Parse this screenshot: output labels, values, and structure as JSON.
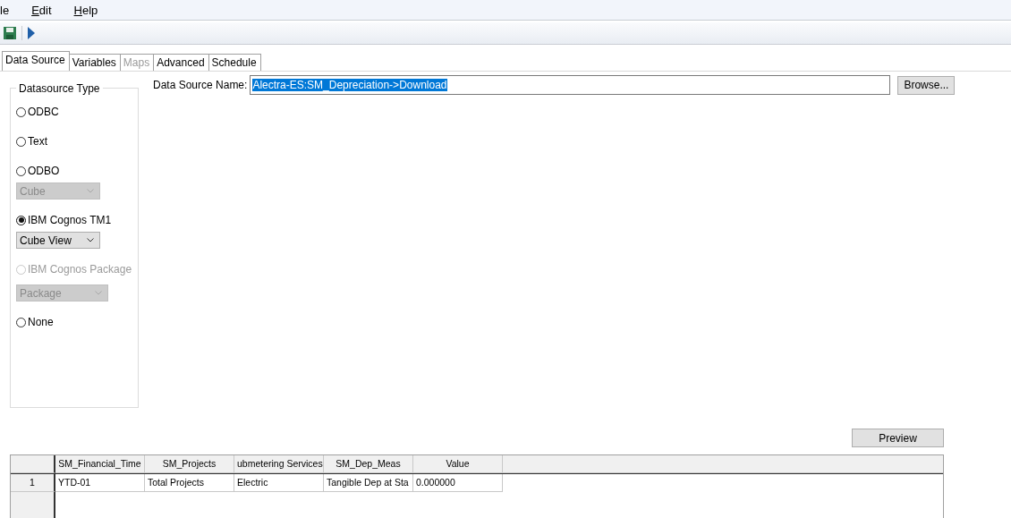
{
  "menu": [
    {
      "label": "le",
      "mnemonic": false
    },
    {
      "label": "Edit",
      "mnemonic": true
    },
    {
      "label": "Help",
      "mnemonic": true
    }
  ],
  "toolbar": [
    {
      "kind": "save"
    },
    {
      "kind": "run"
    }
  ],
  "tabs": [
    {
      "label": "Data Source",
      "selected": true,
      "disabled": false
    },
    {
      "label": "Variables",
      "selected": false,
      "disabled": false
    },
    {
      "label": "Maps",
      "selected": false,
      "disabled": true
    },
    {
      "label": "Advanced",
      "selected": false,
      "disabled": false
    },
    {
      "label": "Schedule",
      "selected": false,
      "disabled": false
    }
  ],
  "datasource_type": {
    "title": "Datasource Type",
    "items": [
      {
        "kind": "radio",
        "label": "ODBC",
        "selected": false,
        "disabled": false
      },
      {
        "kind": "radio",
        "label": "Text",
        "selected": false,
        "disabled": false
      },
      {
        "kind": "radio",
        "label": "ODBO",
        "selected": false,
        "disabled": false
      },
      {
        "kind": "dropdown",
        "value": "Cube",
        "disabled": true
      },
      {
        "kind": "radio",
        "label": "IBM Cognos TM1",
        "selected": true,
        "disabled": false
      },
      {
        "kind": "dropdown",
        "value": "Cube View",
        "disabled": false
      },
      {
        "kind": "radio",
        "label": "IBM Cognos Package",
        "selected": false,
        "disabled": true
      },
      {
        "kind": "dropdown",
        "value": "Package",
        "disabled": true
      },
      {
        "kind": "radio",
        "label": "None",
        "selected": false,
        "disabled": false
      }
    ]
  },
  "data_source_name": {
    "label": "Data Source Name:",
    "value": "Alectra-ES:SM_Depreciation->Download",
    "text_selected": true,
    "button": "Browse..."
  },
  "preview_button": "Preview",
  "grid": {
    "columns": [
      "SM_Financial_Time",
      "SM_Projects",
      "ubmetering Services",
      "SM_Dep_Meas",
      "Value"
    ],
    "rows": [
      {
        "header": "1",
        "cells": [
          "YTD-01",
          "Total Projects",
          "Electric",
          "Tangible Dep at Sta",
          "0.000000"
        ]
      }
    ]
  }
}
